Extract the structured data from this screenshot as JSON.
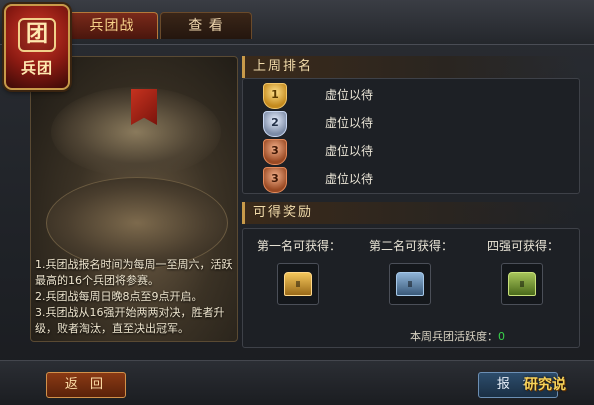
{
  "badge": {
    "char": "团",
    "label": "兵团"
  },
  "tabs": [
    {
      "label": "兵团战",
      "active": true
    },
    {
      "label": "查 看",
      "active": false
    }
  ],
  "description": [
    "1.兵团战报名时间为每周一至周六，活跃最高的16个兵团将参赛。",
    "2.兵团战每周日晚8点至9点开启。",
    "3.兵团战从16强开始两两对决，胜者升级，败者淘汰，直至决出冠军。"
  ],
  "ranking": {
    "title": "上周排名",
    "rows": [
      {
        "rank": "1",
        "medal": "gold",
        "text": "虚位以待"
      },
      {
        "rank": "2",
        "medal": "silver",
        "text": "虚位以待"
      },
      {
        "rank": "3",
        "medal": "bronze",
        "text": "虚位以待"
      },
      {
        "rank": "3",
        "medal": "bronze",
        "text": "虚位以待"
      }
    ]
  },
  "rewards": {
    "title": "可得奖励",
    "items": [
      {
        "label": "第一名可获得：",
        "icon": "gold-chest-icon"
      },
      {
        "label": "第二名可获得：",
        "icon": "blue-chest-icon"
      },
      {
        "label": "四强可获得：",
        "icon": "green-chest-icon"
      }
    ]
  },
  "activity": {
    "label": "本周兵团活跃度：",
    "value": "0"
  },
  "buttons": {
    "back": "返 回",
    "signup": "报 名"
  },
  "watermark": "研究说"
}
